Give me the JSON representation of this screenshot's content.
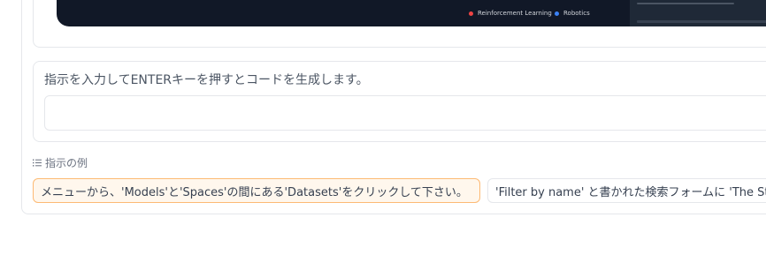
{
  "preview": {
    "tags": [
      {
        "label": "Reinforcement Learning",
        "color": "#ef4444"
      },
      {
        "label": "Robotics",
        "color": "#3b82f6"
      }
    ]
  },
  "prompt": {
    "label": "指示を入力してENTERキーを押すとコードを生成します。",
    "value": "",
    "placeholder": ""
  },
  "examples": {
    "header": "指示の例",
    "items": [
      "メニューから、'Models'と'Spaces'の間にある'Datasets'をクリックして下さい。",
      "'Filter by name' と書かれた検索フォームに 'The Sta"
    ]
  }
}
